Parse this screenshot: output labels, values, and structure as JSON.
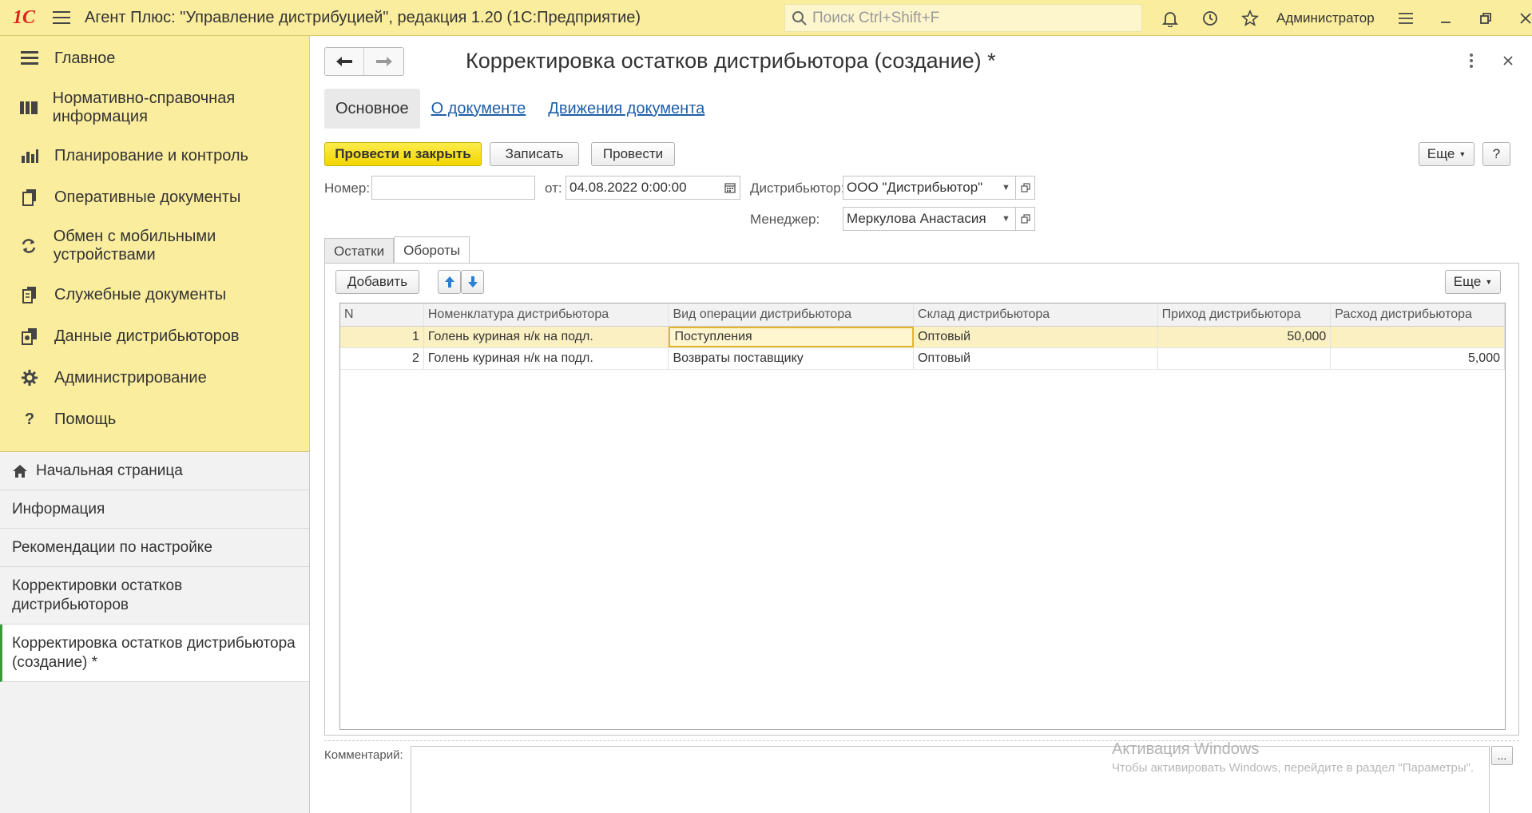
{
  "topbar": {
    "logo": "1С",
    "title": "Агент Плюс: \"Управление дистрибуцией\", редакция 1.20  (1С:Предприятие)",
    "search_placeholder": "Поиск Ctrl+Shift+F",
    "user": "Администратор"
  },
  "sections": [
    {
      "label": "Главное",
      "icon": "menu-lines-icon"
    },
    {
      "label": "Нормативно-справочная информация",
      "icon": "catalog-icon"
    },
    {
      "label": "Планирование и контроль",
      "icon": "bar-chart-icon"
    },
    {
      "label": "Оперативные документы",
      "icon": "documents-icon"
    },
    {
      "label": "Обмен с мобильными устройствами",
      "icon": "sync-icon"
    },
    {
      "label": "Служебные документы",
      "icon": "service-docs-icon"
    },
    {
      "label": "Данные дистрибьюторов",
      "icon": "distributor-data-icon"
    },
    {
      "label": "Администрирование",
      "icon": "gear-icon"
    },
    {
      "label": "Помощь",
      "icon": "help-icon"
    }
  ],
  "nav": [
    {
      "label": "Начальная страница"
    },
    {
      "label": "Информация"
    },
    {
      "label": "Рекомендации по настройке"
    },
    {
      "label": "Корректировки остатков дистрибьюторов"
    },
    {
      "label": "Корректировка остатков дистрибьютора (создание) *"
    }
  ],
  "doc": {
    "title": "Корректировка остатков дистрибьютора (создание) *",
    "tabs": [
      "Основное",
      "О документе",
      "Движения документа"
    ],
    "buttons": {
      "post_close": "Провести и закрыть",
      "save": "Записать",
      "post": "Провести",
      "more": "Еще",
      "help": "?"
    },
    "fields": {
      "number_label": "Номер:",
      "number_value": "",
      "date_label": "от:",
      "date_value": "04.08.2022  0:00:00",
      "distributor_label": "Дистрибьютор:",
      "distributor_value": "ООО \"Дистрибьютор\"",
      "manager_label": "Менеджер:",
      "manager_value": "Меркулова Анастасия"
    },
    "inner_tabs": [
      "Остатки",
      "Обороты"
    ],
    "table_toolbar": {
      "add": "Добавить",
      "more": "Еще"
    },
    "table": {
      "columns": [
        "N",
        "Номенклатура дистрибьютора",
        "Вид операции дистрибьютора",
        "Склад дистрибьютора",
        "Приход дистрибьютора",
        "Расход дистрибьютора"
      ],
      "rows": [
        {
          "n": "1",
          "item": "Голень куриная н/к на подл.",
          "operation": "Поступления",
          "warehouse": "Оптовый",
          "income": "50,000",
          "expense": ""
        },
        {
          "n": "2",
          "item": "Голень куриная н/к на подл.",
          "operation": "Возвраты поставщику",
          "warehouse": "Оптовый",
          "income": "",
          "expense": "5,000"
        }
      ]
    },
    "comment_label": "Комментарий:",
    "comment_button": "...",
    "watermark_title": "Активация Windows",
    "watermark_text": "Чтобы активировать Windows, перейдите в раздел \"Параметры\"."
  },
  "colors": {
    "sidebar_bg": "#FBED9E",
    "primary_button": "#F2D600",
    "link": "#1F5FA8",
    "selected_row": "#FBF0C2"
  }
}
